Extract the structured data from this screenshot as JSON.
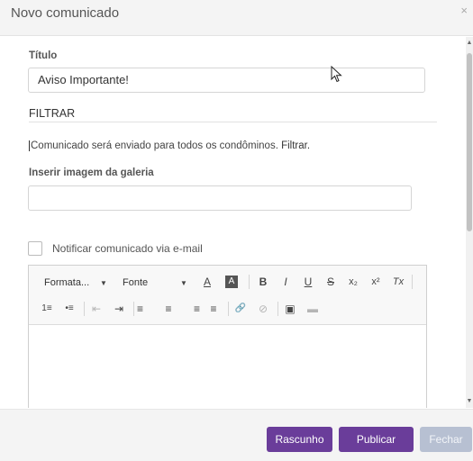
{
  "modal": {
    "title": "Novo comunicado",
    "close_glyph": "×"
  },
  "form": {
    "title_label": "Título",
    "title_value": "Aviso Importante!",
    "filter_section": "FILTRAR",
    "info_text": "Comunicado será enviado para todos os condôminos. ",
    "info_link": "Filtrar.",
    "gallery_label": "Inserir imagem da galeria",
    "gallery_value": "",
    "notify_label": "Notificar comunicado via e-mail",
    "notify_checked": false
  },
  "toolbar": {
    "format_combo": "Formata...",
    "font_combo": "Fonte",
    "buttons_row1": [
      {
        "icon": "text-color-icon",
        "glyph": "A"
      },
      {
        "icon": "background-color-icon",
        "glyph": "A"
      },
      {
        "icon": "bold-icon",
        "glyph": "B"
      },
      {
        "icon": "italic-icon",
        "glyph": "I"
      },
      {
        "icon": "underline-icon",
        "glyph": "U"
      },
      {
        "icon": "strikethrough-icon",
        "glyph": "S"
      },
      {
        "icon": "subscript-icon",
        "glyph": "x₂"
      },
      {
        "icon": "superscript-icon",
        "glyph": "x²"
      },
      {
        "icon": "remove-format-icon",
        "glyph": "Tx"
      }
    ],
    "buttons_row2": [
      {
        "icon": "numbered-list-icon",
        "glyph": "1≡"
      },
      {
        "icon": "bulleted-list-icon",
        "glyph": "•≡"
      },
      {
        "icon": "decrease-indent-icon",
        "glyph": "⇤"
      },
      {
        "icon": "increase-indent-icon",
        "glyph": "⇥"
      },
      {
        "icon": "align-left-icon",
        "glyph": "≡"
      },
      {
        "icon": "align-center-icon",
        "glyph": "≡"
      },
      {
        "icon": "align-right-icon",
        "glyph": "≡"
      },
      {
        "icon": "justify-icon",
        "glyph": "≡"
      },
      {
        "icon": "link-icon",
        "glyph": "🔗"
      },
      {
        "icon": "unlink-icon",
        "glyph": "⊘"
      },
      {
        "icon": "image-icon",
        "glyph": "▣"
      },
      {
        "icon": "horizontal-rule-icon",
        "glyph": "▬"
      }
    ]
  },
  "footer": {
    "draft_label": "Rascunho",
    "publish_label": "Publicar",
    "close_label": "Fechar"
  },
  "colors": {
    "primary": "#6a3d9a",
    "disabled": "#b7c0d2"
  }
}
